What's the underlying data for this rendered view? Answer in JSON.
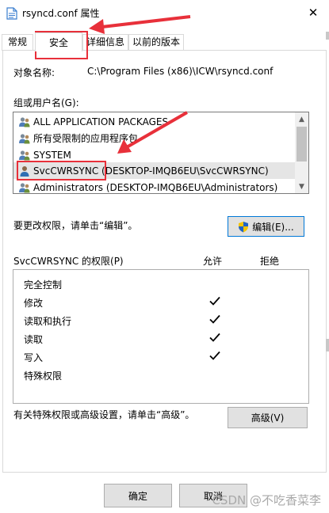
{
  "window": {
    "title": "rsyncd.conf 属性",
    "close_glyph": "✕"
  },
  "tabs": [
    {
      "label": "常规",
      "active": false
    },
    {
      "label": "安全",
      "active": true
    },
    {
      "label": "详细信息",
      "active": false
    },
    {
      "label": "以前的版本",
      "active": false
    }
  ],
  "object_name": {
    "label": "对象名称:",
    "value": "C:\\Program Files (x86)\\ICW\\rsyncd.conf"
  },
  "groups": {
    "label": "组或用户名(G):",
    "items": [
      {
        "name": "ALL APPLICATION PACKAGES",
        "icon": "group-icon",
        "selected": false
      },
      {
        "name": "所有受限制的应用程序包",
        "icon": "group-icon",
        "selected": false
      },
      {
        "name": "SYSTEM",
        "icon": "group-icon",
        "selected": false
      },
      {
        "name": "SvcCWRSYNC (DESKTOP-IMQB6EU\\SvcCWRSYNC)",
        "icon": "user-icon",
        "selected": true
      },
      {
        "name": "Administrators (DESKTOP-IMQB6EU\\Administrators)",
        "icon": "group-icon",
        "selected": false
      }
    ]
  },
  "edit_hint": "要更改权限，请单击“编辑”。",
  "edit_button": "编辑(E)...",
  "permissions": {
    "header": "SvcCWRSYNC 的权限(P)",
    "allow_label": "允许",
    "deny_label": "拒绝",
    "rows": [
      {
        "name": "完全控制",
        "allow": false,
        "deny": false
      },
      {
        "name": "修改",
        "allow": true,
        "deny": false
      },
      {
        "name": "读取和执行",
        "allow": true,
        "deny": false
      },
      {
        "name": "读取",
        "allow": true,
        "deny": false
      },
      {
        "name": "写入",
        "allow": true,
        "deny": false
      },
      {
        "name": "特殊权限",
        "allow": false,
        "deny": false
      }
    ]
  },
  "advanced_hint": "有关特殊权限或高级设置，请单击“高级”。",
  "advanced_button": "高级(V)",
  "ok_button": "确定",
  "cancel_button": "取消",
  "watermark": "CSDN @不吃香菜李",
  "colors": {
    "annotation": "#e8303a",
    "selection": "#e5e5e5",
    "button_face": "#e1e1e1"
  }
}
